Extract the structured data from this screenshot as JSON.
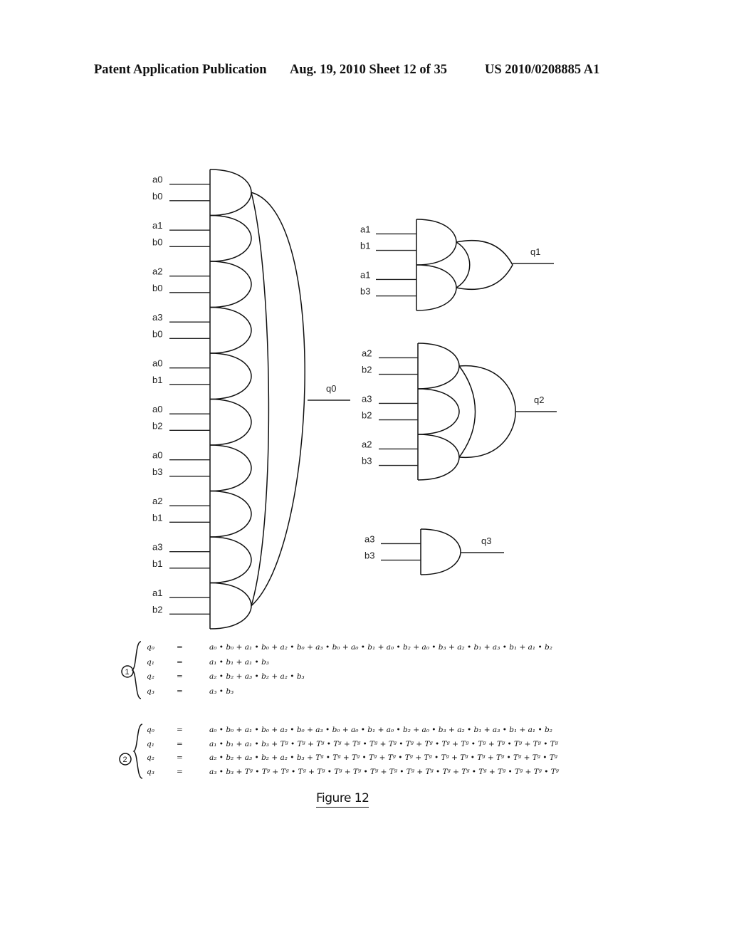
{
  "header": {
    "left": "Patent Application Publication",
    "middle": "Aug. 19, 2010  Sheet 12 of 35",
    "right": "US 2010/0208885 A1"
  },
  "diagram": {
    "q0_block": {
      "output_label": "q0",
      "and_gates": [
        {
          "inputs": [
            "a0",
            "b0"
          ]
        },
        {
          "inputs": [
            "a1",
            "b0"
          ]
        },
        {
          "inputs": [
            "a2",
            "b0"
          ]
        },
        {
          "inputs": [
            "a3",
            "b0"
          ]
        },
        {
          "inputs": [
            "a0",
            "b1"
          ]
        },
        {
          "inputs": [
            "a0",
            "b2"
          ]
        },
        {
          "inputs": [
            "a0",
            "b3"
          ]
        },
        {
          "inputs": [
            "a2",
            "b1"
          ]
        },
        {
          "inputs": [
            "a3",
            "b1"
          ]
        },
        {
          "inputs": [
            "a1",
            "b2"
          ]
        }
      ]
    },
    "q1_block": {
      "output_label": "q1",
      "and_gates": [
        {
          "inputs": [
            "a1",
            "b1"
          ]
        },
        {
          "inputs": [
            "a1",
            "b3"
          ]
        }
      ]
    },
    "q2_block": {
      "output_label": "q2",
      "and_gates": [
        {
          "inputs": [
            "a2",
            "b2"
          ]
        },
        {
          "inputs": [
            "a3",
            "b2"
          ]
        },
        {
          "inputs": [
            "a2",
            "b3"
          ]
        }
      ]
    },
    "q3_block": {
      "output_label": "q3",
      "and_gates": [
        {
          "inputs": [
            "a3",
            "b3"
          ]
        }
      ]
    }
  },
  "equations": {
    "set1": {
      "marker": "1",
      "lines": [
        {
          "lhs": "q₀",
          "eq": "=",
          "rhs": "a₀ • b₀ + a₁ • b₀ + a₂ • b₀ + a₃ • b₀ + a₀ • b₁ + a₀ • b₂ + a₀ • b₃ + a₂ • b₁ + a₃ • b₁ + a₁ • b₂"
        },
        {
          "lhs": "q₁",
          "eq": "=",
          "rhs": "a₁ • b₁ + a₁ • b₃"
        },
        {
          "lhs": "q₂",
          "eq": "=",
          "rhs": "a₂ • b₂ + a₃ • b₂ + a₂ • b₃"
        },
        {
          "lhs": "q₃",
          "eq": "=",
          "rhs": "a₃ • b₃"
        }
      ]
    },
    "set2": {
      "marker": "2",
      "lines": [
        {
          "lhs": "q₀",
          "eq": "=",
          "rhs": "a₀ • b₀ + a₁ • b₀ + a₂ • b₀ + a₃ • b₀ + a₀ • b₁ + a₀ • b₂ + a₀ • b₃ + a₂ • b₁ + a₃ • b₁ + a₁ • b₂"
        },
        {
          "lhs": "q₁",
          "eq": "=",
          "rhs": "a₁ • b₁ + a₁ • b₃ + T_g • T_g + T_g • T_g + T_g • T_g + T_g • T_g + T_g • T_g + T_g • T_g + T_g • T_g + T_g • T_g"
        },
        {
          "lhs": "q₂",
          "eq": "=",
          "rhs": "a₂ • b₂ + a₃ • b₂ + a₂ • b₃ + T_g • T_g + T_g • T_g + T_g • T_g + T_g • T_g + T_g • T_g + T_g • T_g + T_g • T_g"
        },
        {
          "lhs": "q₃",
          "eq": "=",
          "rhs": "a₃ • b₃ + T_g • T_g + T_g • T_g + T_g • T_g + T_g • T_g + T_g • T_g + T_g • T_g + T_g • T_g + T_g • T_g + T_g • T_g"
        }
      ]
    }
  },
  "caption": "Figure 12"
}
